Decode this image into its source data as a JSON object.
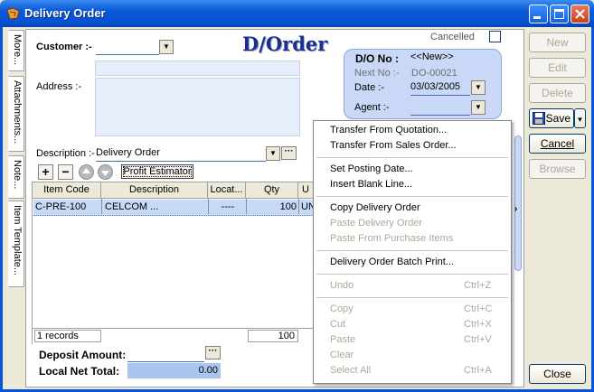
{
  "window": {
    "title": "Delivery Order"
  },
  "side_tabs": [
    "More...",
    "Attachments...",
    "Note...",
    "Item Template..."
  ],
  "doc_title": "D/Order",
  "cancelled_label": "Cancelled",
  "customer": {
    "label": "Customer :-",
    "value": ""
  },
  "address": {
    "label": "Address :-"
  },
  "description": {
    "label": "Description :-",
    "value": "Delivery Order"
  },
  "doc": {
    "do_no_label": "D/O No :",
    "do_no_value": "<<New>>",
    "next_no_label": "Next No :-",
    "next_no_value": "DO-00021",
    "date_label": "Date :-",
    "date_value": "03/03/2005",
    "agent_label": "Agent :-",
    "agent_value": ""
  },
  "toolbar": {
    "plus": "+",
    "minus": "−",
    "profit_estimator": "Profit Estimator"
  },
  "grid": {
    "columns": [
      "Item Code",
      "Description",
      "Locat...",
      "Qty",
      "U"
    ],
    "rows": [
      {
        "item_code": "C-PRE-100",
        "description": "CELCOM ...",
        "location": "----",
        "qty": "100",
        "uom": "UN"
      }
    ],
    "record_count": "1 records",
    "total_qty": "100"
  },
  "deposit": {
    "label": "Deposit Amount:",
    "value": ""
  },
  "net_total": {
    "label": "Local Net Total:",
    "value": "0.00"
  },
  "buttons": {
    "new": "New",
    "edit": "Edit",
    "delete": "Delete",
    "save": "Save",
    "cancel": "Cancel",
    "browse": "Browse",
    "close": "Close"
  },
  "context_menu": {
    "transfer_quotation": "Transfer From Quotation...",
    "transfer_sales_order": "Transfer From Sales Order...",
    "set_posting_date": "Set Posting Date...",
    "insert_blank_line": "Insert Blank Line...",
    "copy_do": "Copy Delivery Order",
    "paste_do": "Paste Delivery Order",
    "paste_purchase": "Paste From Purchase Items",
    "batch_print": "Delivery Order Batch Print...",
    "undo": "Undo",
    "undo_sc": "Ctrl+Z",
    "copy": "Copy",
    "copy_sc": "Ctrl+C",
    "cut": "Cut",
    "cut_sc": "Ctrl+X",
    "paste": "Paste",
    "paste_sc": "Ctrl+V",
    "clear": "Clear",
    "select_all": "Select All",
    "select_all_sc": "Ctrl+A"
  }
}
